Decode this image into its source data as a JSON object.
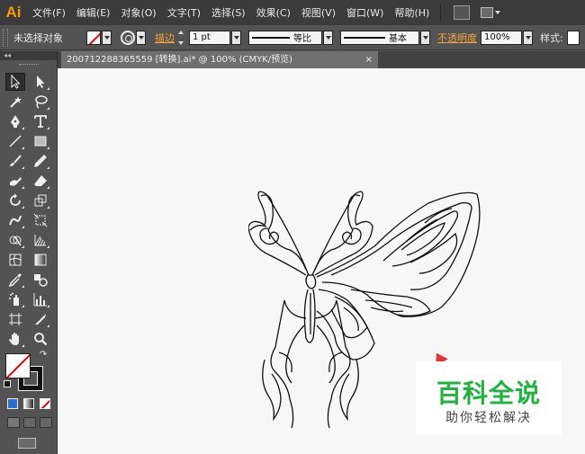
{
  "app": {
    "logo": "Ai"
  },
  "menubar": {
    "items": [
      "文件(F)",
      "编辑(E)",
      "对象(O)",
      "文字(T)",
      "选择(S)",
      "效果(C)",
      "视图(V)",
      "窗口(W)",
      "帮助(H)"
    ]
  },
  "controlbar": {
    "selection": "未选择对象",
    "stroke_link": "描边",
    "stroke_weight": "1 pt",
    "stroke_style_1": "等比",
    "stroke_style_2": "基本",
    "opacity_link": "不透明度",
    "opacity_value": "100%",
    "style_label": "样式:"
  },
  "document": {
    "tab_title": "200712288365559 [转换].ai* @ 100% (CMYK/预览)",
    "close_glyph": "×"
  },
  "toolbox": {
    "collapse_glyph": "◂◂"
  },
  "watermark": {
    "title": "百科全说",
    "subtitle": "助你轻松解决"
  },
  "colors": {
    "menubar_bg": "#3b3b3b",
    "panel_bg": "#535353",
    "canvas_bg": "#f7f7f7",
    "accent_orange": "#f3a33a",
    "watermark_green": "#1fb33c"
  },
  "icons": [
    "selection-tool",
    "direct-selection-tool",
    "magic-wand-tool",
    "lasso-tool",
    "pen-tool",
    "type-tool",
    "line-segment-tool",
    "rectangle-tool",
    "paintbrush-tool",
    "pencil-tool",
    "blob-brush-tool",
    "eraser-tool",
    "rotate-tool",
    "scale-tool",
    "warp-tool",
    "free-transform-tool",
    "shape-builder-tool",
    "perspective-grid-tool",
    "mesh-tool",
    "gradient-tool",
    "eyedropper-tool",
    "blend-tool",
    "symbol-sprayer-tool",
    "column-graph-tool",
    "artboard-tool",
    "slice-tool",
    "hand-tool",
    "zoom-tool"
  ]
}
